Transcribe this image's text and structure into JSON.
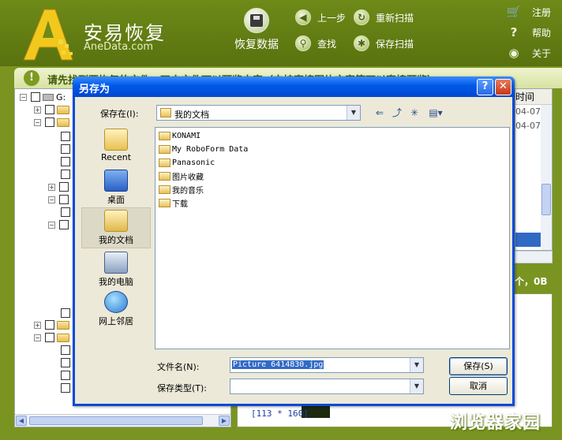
{
  "app": {
    "title": "安易恢复",
    "site": "AneData.com",
    "toolbar": {
      "recover": "恢复数据",
      "back": "上一步",
      "rescan": "重新扫描",
      "find": "查找",
      "save_scan": "保存扫描"
    },
    "side_menu": {
      "register": "注册",
      "help": "帮助",
      "about": "关于"
    },
    "tip": "请先找到要恢复的文件，双击文件可以预览内容（支持直接图片文字等可以直接预览）",
    "tree_root": "G:",
    "list": {
      "header": "时间",
      "cells": [
        "04-07",
        "04-07"
      ]
    },
    "count_label": "个，0B",
    "thumbnail_label": "[113 * 160]",
    "watermark": "浏览器家园"
  },
  "dialog": {
    "title": "另存为",
    "save_in_label": "保存在(I):",
    "save_in_value": "我的文档",
    "places": [
      "Recent",
      "桌面",
      "我的文档",
      "我的电脑",
      "网上邻居"
    ],
    "files": [
      "KONAMI",
      "My RoboForm Data",
      "Panasonic",
      "图片收藏",
      "我的音乐",
      "下载"
    ],
    "filename_label": "文件名(N):",
    "filename_value": "Picture 6414830.jpg",
    "filetype_label": "保存类型(T):",
    "filetype_value": "",
    "save_button": "保存(S)",
    "cancel_button": "取消"
  },
  "colors": {
    "header_bg": "#6e8a18",
    "dialog_titlebar": "#0058e8",
    "selection": "#316ac5"
  }
}
